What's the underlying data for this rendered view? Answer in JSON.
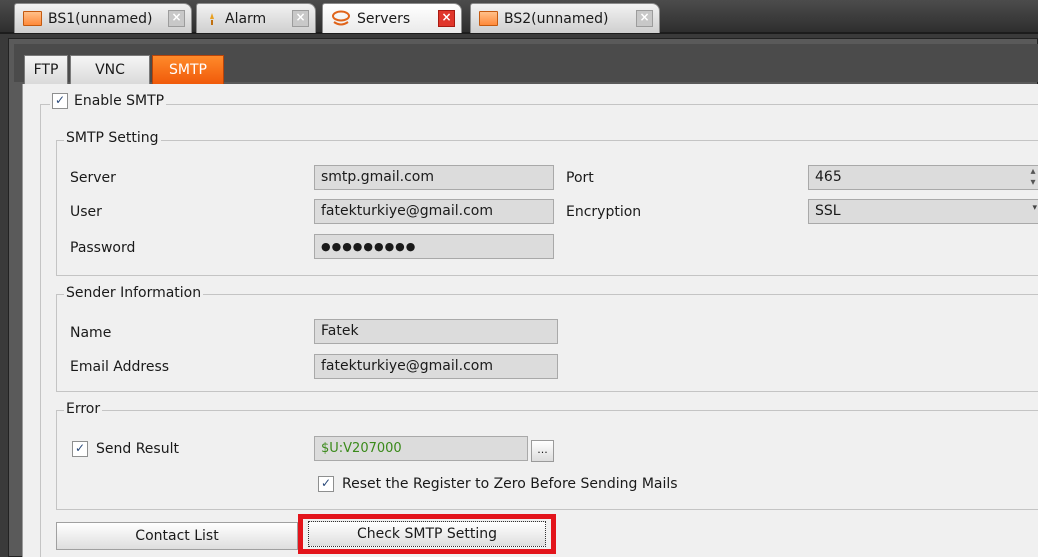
{
  "doc_tabs": [
    {
      "label": "BS1(unnamed)",
      "icon": "window-icon"
    },
    {
      "label": "Alarm",
      "icon": "alarm-icon"
    },
    {
      "label": "Servers",
      "icon": "server-icon",
      "active": true
    },
    {
      "label": "BS2(unnamed)",
      "icon": "window-icon"
    }
  ],
  "close_glyph": "×",
  "sub_tabs": [
    "FTP",
    "VNC",
    "SMTP"
  ],
  "enable_smtp": {
    "label": "Enable SMTP",
    "checked": true
  },
  "smtp_setting": {
    "title": "SMTP Setting",
    "server_label": "Server",
    "server_value": "smtp.gmail.com",
    "user_label": "User",
    "user_value": "fatekturkiye@gmail.com",
    "password_label": "Password",
    "password_value": "●●●●●●●●●",
    "port_label": "Port",
    "port_value": "465",
    "encryption_label": "Encryption",
    "encryption_value": "SSL"
  },
  "sender": {
    "title": "Sender Information",
    "name_label": "Name",
    "name_value": "Fatek",
    "email_label": "Email Address",
    "email_value": "fatekturkiye@gmail.com"
  },
  "error": {
    "title": "Error",
    "send_result_label": "Send Result",
    "send_result_checked": true,
    "register_value": "$U:V207000",
    "browse_label": "...",
    "reset_label": "Reset the Register to Zero Before Sending Mails",
    "reset_checked": true
  },
  "buttons": {
    "contact_list": "Contact List",
    "check_smtp": "Check SMTP Setting"
  },
  "colors": {
    "accent": "#f26a12",
    "highlight": "#e3141b"
  }
}
